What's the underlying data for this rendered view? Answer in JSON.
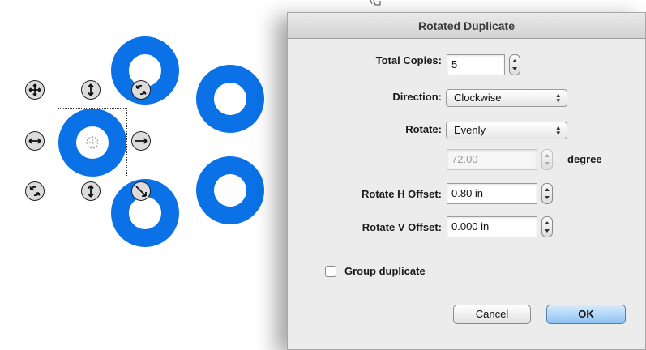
{
  "dialog": {
    "title": "Rotated Duplicate",
    "total_copies": {
      "label": "Total Copies:",
      "value": "5"
    },
    "direction": {
      "label": "Direction:",
      "value": "Clockwise"
    },
    "rotate": {
      "label": "Rotate:",
      "value": "Evenly"
    },
    "angle": {
      "value": "72.00",
      "unit": "degree"
    },
    "h_offset": {
      "label": "Rotate H Offset:",
      "value": "0.80 in"
    },
    "v_offset": {
      "label": "Rotate V Offset:",
      "value": "0.000 in"
    },
    "group_duplicate": {
      "label": "Group duplicate",
      "checked": false
    },
    "cancel_label": "Cancel",
    "ok_label": "OK"
  },
  "canvas": {
    "ring_color": "#0a72e6",
    "handle_icons": [
      "move-icon",
      "vertical-resize-icon",
      "rotate-icon",
      "horizontal-resize-icon",
      "rotate-icon",
      "vertical-resize-icon",
      "diagonal-resize-icon"
    ]
  }
}
